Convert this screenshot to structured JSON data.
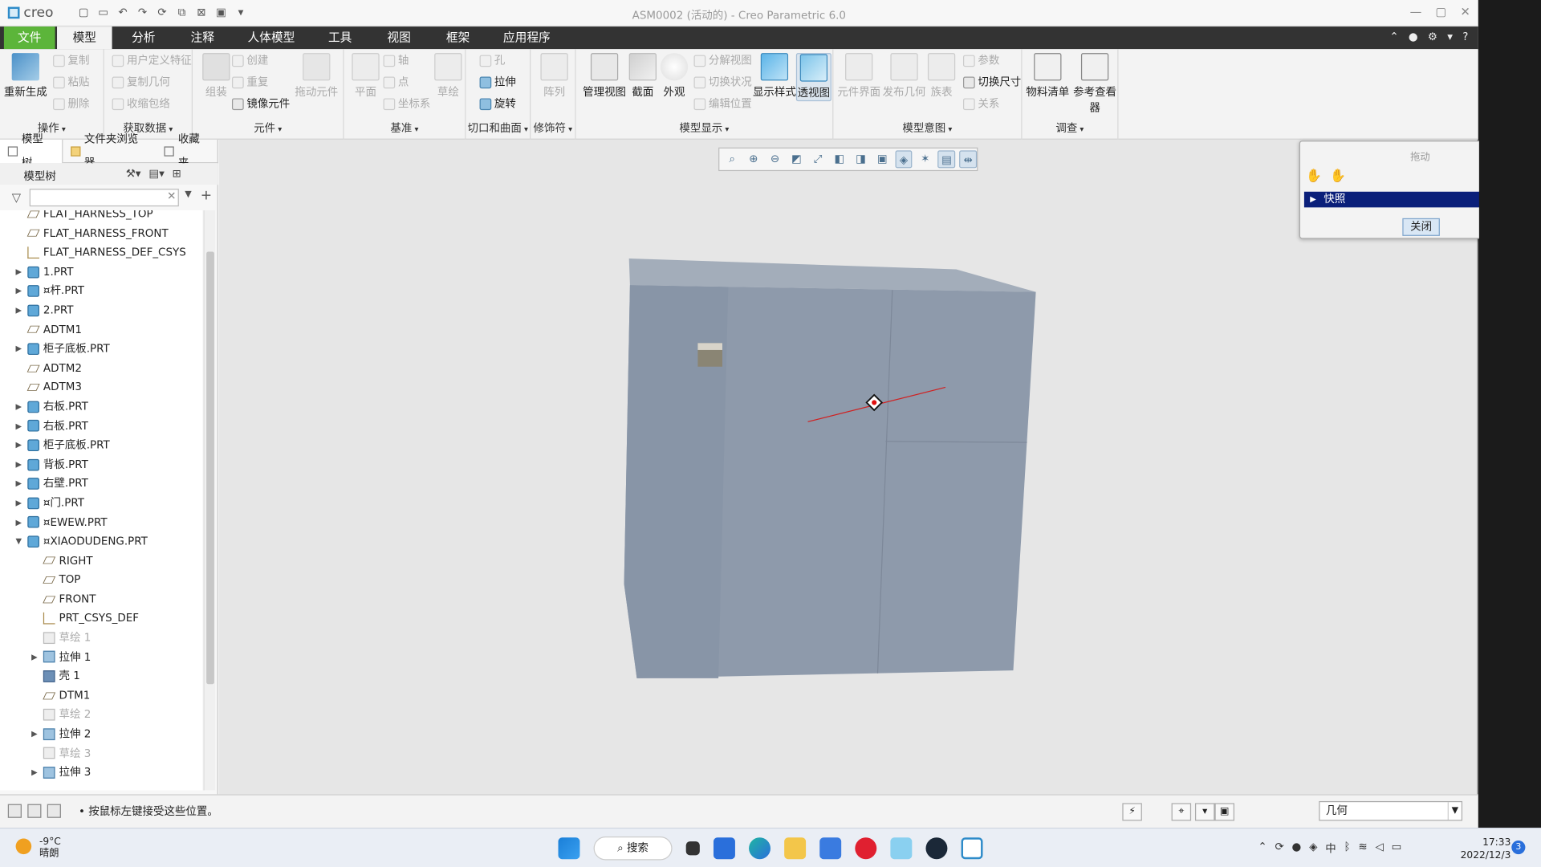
{
  "window": {
    "app_name": "creo",
    "title": "ASM0002 (活动的) - Creo Parametric 6.0"
  },
  "menu_tabs": [
    "文件",
    "模型",
    "分析",
    "注释",
    "人体模型",
    "工具",
    "视图",
    "框架",
    "应用程序"
  ],
  "ribbon": {
    "groups": [
      {
        "label": "操作",
        "buttons": [
          "重新生成",
          "复制",
          "粘贴",
          "删除"
        ]
      },
      {
        "label": "获取数据",
        "buttons": [
          "用户定义特征",
          "复制几何",
          "收缩包络"
        ]
      },
      {
        "label": "元件",
        "buttons": [
          "组装",
          "创建",
          "重复",
          "镜像元件",
          "拖动元件"
        ]
      },
      {
        "label": "基准",
        "buttons": [
          "平面",
          "轴",
          "点",
          "坐标系",
          "草绘"
        ]
      },
      {
        "label": "切口和曲面",
        "buttons": [
          "孔",
          "拉伸",
          "旋转"
        ]
      },
      {
        "label": "修饰符",
        "buttons": [
          "阵列"
        ]
      },
      {
        "label": "模型显示",
        "buttons": [
          "管理视图",
          "截面",
          "外观",
          "分解视图",
          "切换状况",
          "编辑位置",
          "显示样式",
          "透视图"
        ]
      },
      {
        "label": "模型意图",
        "buttons": [
          "元件界面",
          "发布几何",
          "族表",
          "参数",
          "切换尺寸",
          "关系"
        ]
      },
      {
        "label": "调查",
        "buttons": [
          "物料清单",
          "参考查看器"
        ]
      }
    ]
  },
  "panel": {
    "tabs": [
      "模型树",
      "文件夹浏览器",
      "收藏夹"
    ],
    "tree_header": "模型树",
    "filter_placeholder": "",
    "rows": [
      {
        "label": "FLAT_HARNESS_TOP",
        "icon": "plane",
        "expand": "",
        "indent": 1,
        "dim": false
      },
      {
        "label": "FLAT_HARNESS_FRONT",
        "icon": "plane",
        "expand": "",
        "indent": 1,
        "dim": false
      },
      {
        "label": "FLAT_HARNESS_DEF_CSYS",
        "icon": "csys",
        "expand": "",
        "indent": 1,
        "dim": false
      },
      {
        "label": "1.PRT",
        "icon": "part",
        "expand": "▶",
        "indent": 1,
        "dim": false
      },
      {
        "label": "¤杆.PRT",
        "icon": "part",
        "expand": "▶",
        "indent": 1,
        "dim": false
      },
      {
        "label": "2.PRT",
        "icon": "part",
        "expand": "▶",
        "indent": 1,
        "dim": false
      },
      {
        "label": "ADTM1",
        "icon": "plane",
        "expand": "",
        "indent": 1,
        "dim": false
      },
      {
        "label": "柜子底板.PRT",
        "icon": "part",
        "expand": "▶",
        "indent": 1,
        "dim": false
      },
      {
        "label": "ADTM2",
        "icon": "plane",
        "expand": "",
        "indent": 1,
        "dim": false
      },
      {
        "label": "ADTM3",
        "icon": "plane",
        "expand": "",
        "indent": 1,
        "dim": false
      },
      {
        "label": "右板.PRT",
        "icon": "part",
        "expand": "▶",
        "indent": 1,
        "dim": false
      },
      {
        "label": "右板.PRT",
        "icon": "part",
        "expand": "▶",
        "indent": 1,
        "dim": false
      },
      {
        "label": "柜子底板.PRT",
        "icon": "part",
        "expand": "▶",
        "indent": 1,
        "dim": false
      },
      {
        "label": "背板.PRT",
        "icon": "part",
        "expand": "▶",
        "indent": 1,
        "dim": false
      },
      {
        "label": "右壁.PRT",
        "icon": "part",
        "expand": "▶",
        "indent": 1,
        "dim": false
      },
      {
        "label": "¤门.PRT",
        "icon": "part",
        "expand": "▶",
        "indent": 1,
        "dim": false
      },
      {
        "label": "¤EWEW.PRT",
        "icon": "part",
        "expand": "▶",
        "indent": 1,
        "dim": false
      },
      {
        "label": "¤XIAODUDENG.PRT",
        "icon": "part",
        "expand": "▼",
        "indent": 1,
        "dim": false
      },
      {
        "label": "RIGHT",
        "icon": "plane",
        "expand": "",
        "indent": 2,
        "dim": false
      },
      {
        "label": "TOP",
        "icon": "plane",
        "expand": "",
        "indent": 2,
        "dim": false
      },
      {
        "label": "FRONT",
        "icon": "plane",
        "expand": "",
        "indent": 2,
        "dim": false
      },
      {
        "label": "PRT_CSYS_DEF",
        "icon": "csys",
        "expand": "",
        "indent": 2,
        "dim": false
      },
      {
        "label": "草绘 1",
        "icon": "sketch",
        "expand": "",
        "indent": 2,
        "dim": true
      },
      {
        "label": "拉伸 1",
        "icon": "feat",
        "expand": "▶",
        "indent": 2,
        "dim": false
      },
      {
        "label": "壳 1",
        "icon": "shell",
        "expand": "",
        "indent": 2,
        "dim": false
      },
      {
        "label": "DTM1",
        "icon": "plane",
        "expand": "",
        "indent": 2,
        "dim": false
      },
      {
        "label": "草绘 2",
        "icon": "sketch",
        "expand": "",
        "indent": 2,
        "dim": true
      },
      {
        "label": "拉伸 2",
        "icon": "feat",
        "expand": "▶",
        "indent": 2,
        "dim": false
      },
      {
        "label": "草绘 3",
        "icon": "sketch",
        "expand": "",
        "indent": 2,
        "dim": true
      },
      {
        "label": "拉伸 3",
        "icon": "feat",
        "expand": "▶",
        "indent": 2,
        "dim": false
      }
    ]
  },
  "status": {
    "message": "按鼠标左键接受这些位置。",
    "filter_value": "几何"
  },
  "drag_dialog": {
    "title": "拖动",
    "snapshot_label": "快照",
    "close_button": "关闭"
  },
  "taskbar": {
    "temperature": "-9°C",
    "weather": "晴朗",
    "search_label": "搜索",
    "time": "17:33",
    "date": "2022/12/3",
    "notification_count": "3"
  },
  "colors": {
    "file_tab": "#5cb53a",
    "model_face": "#8e9aab",
    "selection": "#0a1f7a"
  }
}
